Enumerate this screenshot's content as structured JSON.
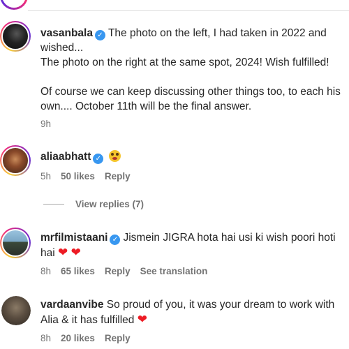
{
  "comments": [
    {
      "username": "vasanbala",
      "verified": true,
      "lines": [
        "The photo on the left, I had taken in 2022 and",
        "wished...",
        "The photo on the right at the same spot, 2024! Wish fulfilled!",
        "",
        "Of course we can keep discussing other things too, to each his",
        "own.... October 11th will be the final answer."
      ],
      "time": "9h"
    },
    {
      "username": "aliaabhatt",
      "verified": true,
      "emoji": "flushed-face-emoji",
      "time": "5h",
      "likes": "50 likes",
      "reply": "Reply"
    },
    {
      "username": "mrfilmistaani",
      "verified": true,
      "lines": [
        "Jismein JIGRA hota hai usi ki wish poori hoti",
        "hai"
      ],
      "time": "8h",
      "likes": "65 likes",
      "reply": "Reply",
      "translate": "See translation"
    },
    {
      "username": "vardaanvibe",
      "verified": false,
      "lines": [
        "So proud of you, it was your dream to work with",
        "Alia & it has fulfilled"
      ],
      "time": "8h",
      "likes": "20 likes",
      "reply": "Reply"
    }
  ],
  "view_replies": "View replies (7)",
  "colors": {
    "verified": "#3897f0",
    "heart": "#ed1b24",
    "meta": "#737373"
  }
}
